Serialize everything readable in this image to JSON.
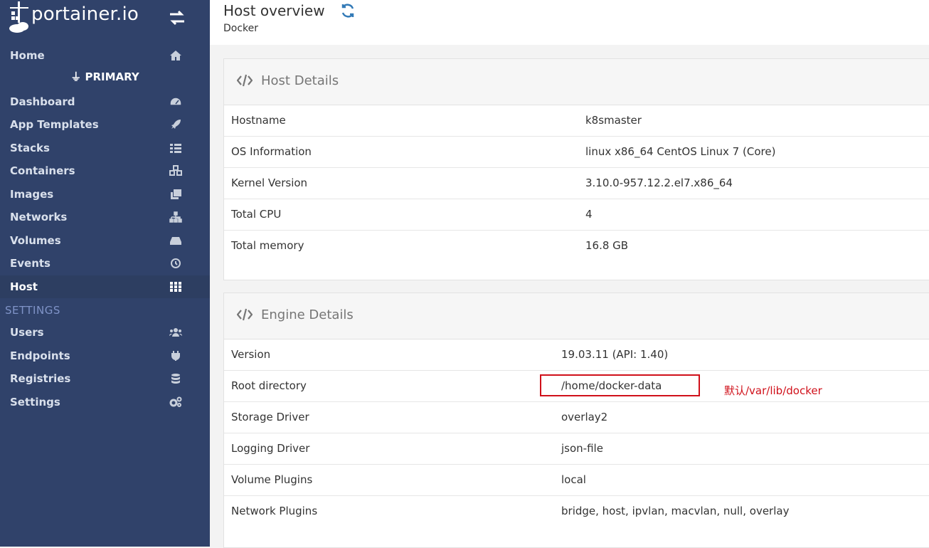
{
  "brand": {
    "name": "portainer.io"
  },
  "sidebar": {
    "home": "Home",
    "environment": "PRIMARY",
    "items": [
      {
        "label": "Dashboard",
        "icon": "tachometer-icon"
      },
      {
        "label": "App Templates",
        "icon": "rocket-icon"
      },
      {
        "label": "Stacks",
        "icon": "th-list-icon"
      },
      {
        "label": "Containers",
        "icon": "cubes-icon"
      },
      {
        "label": "Images",
        "icon": "clone-icon"
      },
      {
        "label": "Networks",
        "icon": "sitemap-icon"
      },
      {
        "label": "Volumes",
        "icon": "hdd-icon"
      },
      {
        "label": "Events",
        "icon": "history-icon"
      },
      {
        "label": "Host",
        "icon": "th-icon"
      }
    ],
    "settings_header": "SETTINGS",
    "settings_items": [
      {
        "label": "Users",
        "icon": "users-icon"
      },
      {
        "label": "Endpoints",
        "icon": "plug-icon"
      },
      {
        "label": "Registries",
        "icon": "database-icon"
      },
      {
        "label": "Settings",
        "icon": "cogs-icon"
      }
    ]
  },
  "header": {
    "title": "Host overview",
    "breadcrumb": "Docker"
  },
  "host_details": {
    "title": "Host Details",
    "rows": [
      {
        "key": "Hostname",
        "value": "k8smaster"
      },
      {
        "key": "OS Information",
        "value": "linux x86_64 CentOS Linux 7 (Core)"
      },
      {
        "key": "Kernel Version",
        "value": "3.10.0-957.12.2.el7.x86_64"
      },
      {
        "key": "Total CPU",
        "value": "4"
      },
      {
        "key": "Total memory",
        "value": "16.8 GB"
      }
    ]
  },
  "engine_details": {
    "title": "Engine Details",
    "rows": [
      {
        "key": "Version",
        "value": "19.03.11 (API: 1.40)"
      },
      {
        "key": "Root directory",
        "value": "/home/docker-data"
      },
      {
        "key": "Storage Driver",
        "value": "overlay2"
      },
      {
        "key": "Logging Driver",
        "value": "json-file"
      },
      {
        "key": "Volume Plugins",
        "value": "local"
      },
      {
        "key": "Network Plugins",
        "value": "bridge, host, ipvlan, macvlan, null, overlay"
      }
    ]
  },
  "annotation": {
    "note": "默认/var/lib/docker",
    "color": "#d0101a"
  },
  "colors": {
    "sidebar": "#30426a",
    "accent": "#337ab7"
  }
}
